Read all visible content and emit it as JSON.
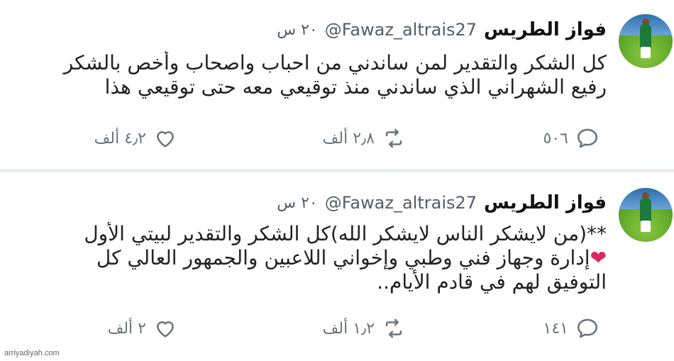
{
  "tweets": [
    {
      "name": "فواز الطريس",
      "handle": "@Fawaz_altrais27",
      "time": "٢٠ س",
      "lines": [
        "كل الشكر والتقدير لمن ساندني من احباب واصحاب وأخص بالشكر",
        "رفيع الشهراني الذي ساندني منذ توقيعي معه حتى توقيعي هذا"
      ],
      "replies": "٥٠٦",
      "retweets": "٢٫٨ ألف",
      "likes": "٤٫٢ ألف"
    },
    {
      "name": "فواز الطريس",
      "handle": "@Fawaz_altrais27",
      "time": "٢٠ س",
      "lines": [
        "**(من لايشكر الناس لايشكر الله)كل الشكر والتقدير لبيتي الأول",
        "إدارة وجهاز فني وطبي وإخواني اللاعبين والجمهور العالي كل",
        "التوفيق لهم في قادم الأيام.."
      ],
      "heart_emoji": "❤",
      "replies": "١٤١",
      "retweets": "١٫٢ ألف",
      "likes": "٢ ألف"
    }
  ],
  "watermark": "arriyadiyah.com",
  "icons": {
    "reply": "reply-icon",
    "retweet": "retweet-icon",
    "like": "heart-icon"
  },
  "colors": {
    "icon_gray": "#6b737b",
    "divider": "#e6ecf0",
    "heart_emoji": "#e0245e"
  }
}
